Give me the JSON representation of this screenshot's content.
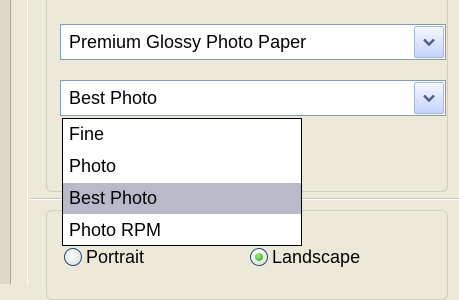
{
  "paper_type": {
    "selected": "Premium Glossy Photo Paper",
    "arrow_icon": "chevron-down-icon"
  },
  "print_quality": {
    "selected": "Best Photo",
    "arrow_icon": "chevron-down-icon",
    "options": [
      "Fine",
      "Photo",
      "Best Photo",
      "Photo RPM"
    ],
    "highlighted_index": 2
  },
  "orientation": {
    "portrait_label": "Portrait",
    "landscape_label": "Landscape",
    "selected": "Landscape"
  },
  "colors": {
    "window_bg": "#ece9d8",
    "highlight": "#b8b9c9",
    "combo_border": "#7f9db9",
    "radio_dot": "#27a30a"
  }
}
